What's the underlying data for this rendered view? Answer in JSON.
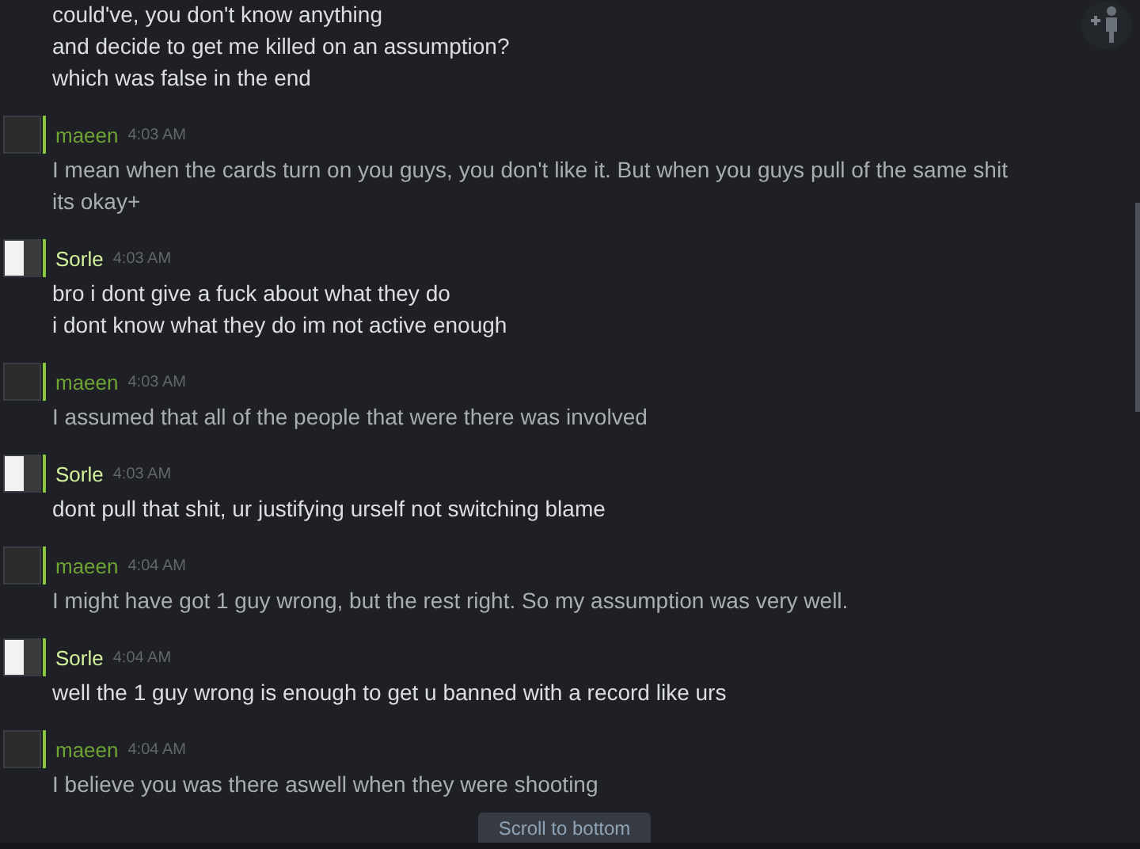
{
  "messages": [
    {
      "kind": "self",
      "lines": [
        "could've, you don't know anything",
        "and decide to get me killed on an assumption?",
        "which was false in the end"
      ]
    },
    {
      "kind": "other",
      "author": "maeen",
      "time": "4:03 AM",
      "lines": [
        "I mean when the cards turn on you guys, you don't like it. But when you guys pull of the same shit its okay+"
      ]
    },
    {
      "kind": "self",
      "author": "Sorle",
      "time": "4:03 AM",
      "lines": [
        "bro i dont give a fuck about what they do",
        "i dont know what they do im not active enough"
      ]
    },
    {
      "kind": "other",
      "author": "maeen",
      "time": "4:03 AM",
      "lines": [
        "I assumed that all of the people that were there was involved"
      ]
    },
    {
      "kind": "self",
      "author": "Sorle",
      "time": "4:03 AM",
      "lines": [
        "dont pull that shit, ur justifying urself not switching blame"
      ]
    },
    {
      "kind": "other",
      "author": "maeen",
      "time": "4:04 AM",
      "lines": [
        "I might have got 1 guy wrong, but the rest right. So my assumption was very well."
      ]
    },
    {
      "kind": "self",
      "author": "Sorle",
      "time": "4:04 AM",
      "lines": [
        "well the 1 guy wrong is enough to get u banned with a record like urs"
      ]
    },
    {
      "kind": "other",
      "author": "maeen",
      "time": "4:04 AM",
      "lines": [
        "I believe you was there aswell when they were shooting"
      ]
    }
  ],
  "scroll_button": "Scroll to bottom"
}
